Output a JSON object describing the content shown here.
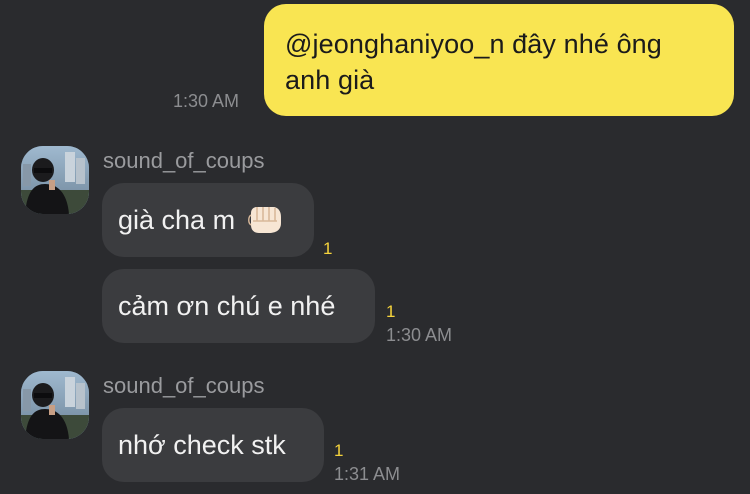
{
  "conversation": {
    "outgoing": {
      "line1": "@jeonghaniyoo_n đây nhé ông",
      "line2": "anh già",
      "time": "1:30 AM"
    },
    "group1": {
      "sender": "sound_of_coups",
      "msg1": {
        "text": "già cha m",
        "emoji": "fist-bump-emoji",
        "unread": "1"
      },
      "msg2": {
        "text": "cảm ơn chú e nhé",
        "unread": "1",
        "time": "1:30 AM"
      }
    },
    "group2": {
      "sender": "sound_of_coups",
      "msg1": {
        "text": "nhớ check stk",
        "unread": "1",
        "time": "1:31 AM"
      }
    }
  },
  "colors": {
    "background": "#2a2b2e",
    "outgoing_bubble": "#f9e552",
    "incoming_bubble": "#3b3c3f",
    "unread_count": "#f5d33c",
    "timestamp": "#8c8d90"
  }
}
